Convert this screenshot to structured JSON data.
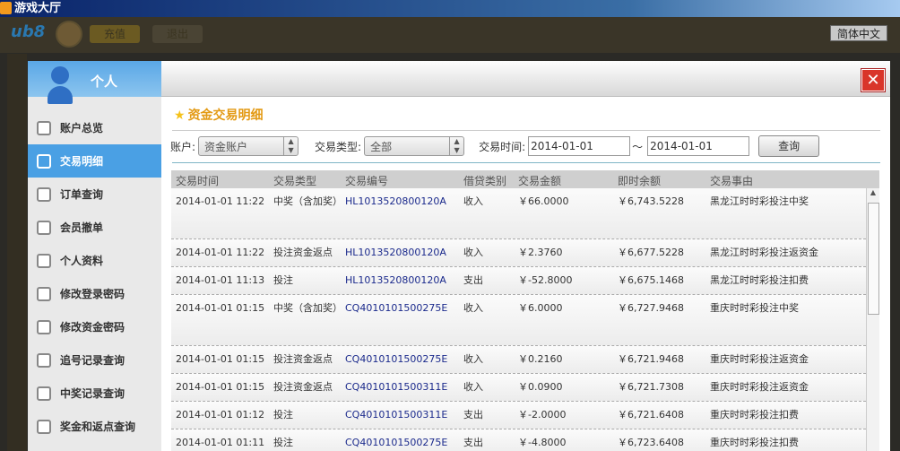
{
  "window": {
    "title": "游戏大厅"
  },
  "appbar": {
    "logo": "ub8",
    "recharge": "充值",
    "logout": "退出",
    "language": "简体中文"
  },
  "sidebar": {
    "title": "个人",
    "items": [
      {
        "label": "账户总览",
        "icon": "document-icon"
      },
      {
        "label": "交易明细",
        "icon": "list-icon",
        "active": true
      },
      {
        "label": "订单查询",
        "icon": "order-icon"
      },
      {
        "label": "会员撤单",
        "icon": "cancel-icon"
      },
      {
        "label": "个人资料",
        "icon": "user-icon"
      },
      {
        "label": "修改登录密码",
        "icon": "lock-icon"
      },
      {
        "label": "修改资金密码",
        "icon": "lock-icon"
      },
      {
        "label": "追号记录查询",
        "icon": "search-icon"
      },
      {
        "label": "中奖记录查询",
        "icon": "search-icon"
      },
      {
        "label": "奖金和返点查询",
        "icon": "search-icon"
      }
    ]
  },
  "main": {
    "title": "资金交易明细",
    "close": "✕",
    "filters": {
      "account_label": "账户:",
      "account_value": "资金账户",
      "type_label": "交易类型:",
      "type_value": "全部",
      "time_label": "交易时间:",
      "from": "2014-01-01",
      "sep": "～",
      "to": "2014-01-01",
      "query": "查询"
    },
    "columns": [
      "交易时间",
      "交易类型",
      "交易编号",
      "借贷类别",
      "交易金额",
      "即时余额",
      "交易事由"
    ],
    "rows": [
      [
        "2014-01-01 11:22",
        "中奖（含加奖）",
        "HL1013520800120A",
        "收入",
        "￥66.0000",
        "￥6,743.5228",
        "黑龙江时时彩投注中奖"
      ],
      [
        "2014-01-01 11:22",
        "投注资金返点",
        "HL1013520800120A",
        "收入",
        "￥2.3760",
        "￥6,677.5228",
        "黑龙江时时彩投注返资金"
      ],
      [
        "2014-01-01 11:13",
        "投注",
        "HL1013520800120A",
        "支出",
        "￥-52.8000",
        "￥6,675.1468",
        "黑龙江时时彩投注扣费"
      ],
      [
        "2014-01-01 01:15",
        "中奖（含加奖）",
        "CQ4010101500275E",
        "收入",
        "￥6.0000",
        "￥6,727.9468",
        "重庆时时彩投注中奖"
      ],
      [
        "2014-01-01 01:15",
        "投注资金返点",
        "CQ4010101500275E",
        "收入",
        "￥0.2160",
        "￥6,721.9468",
        "重庆时时彩投注返资金"
      ],
      [
        "2014-01-01 01:15",
        "投注资金返点",
        "CQ4010101500311E",
        "收入",
        "￥0.0900",
        "￥6,721.7308",
        "重庆时时彩投注返资金"
      ],
      [
        "2014-01-01 01:12",
        "投注",
        "CQ4010101500311E",
        "支出",
        "￥-2.0000",
        "￥6,721.6408",
        "重庆时时彩投注扣费"
      ],
      [
        "2014-01-01 01:11",
        "投注",
        "CQ4010101500275E",
        "支出",
        "￥-4.8000",
        "￥6,723.6408",
        "重庆时时彩投注扣费"
      ]
    ]
  }
}
